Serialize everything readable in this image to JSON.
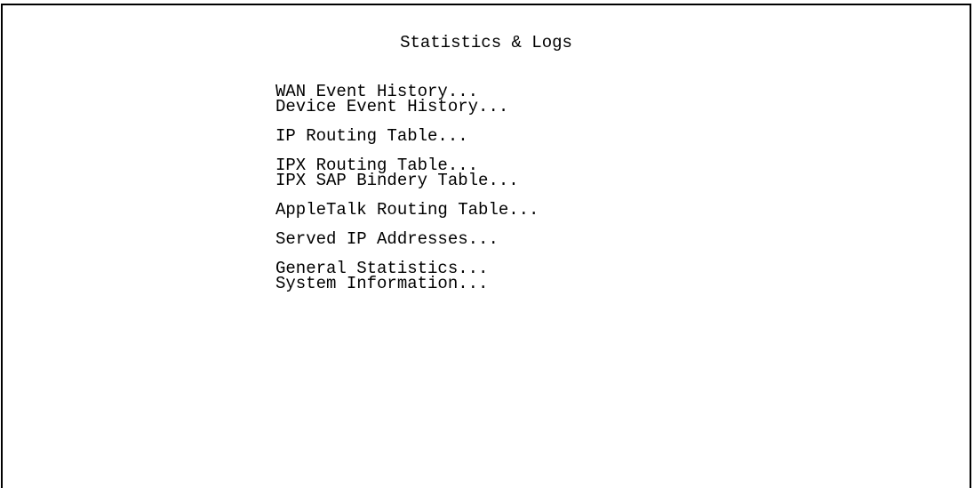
{
  "screen": {
    "title": "Statistics & Logs"
  },
  "menu": {
    "groups": [
      {
        "items": [
          "WAN Event History...",
          "Device Event History..."
        ]
      },
      {
        "items": [
          "IP Routing Table..."
        ]
      },
      {
        "items": [
          "IPX Routing Table...",
          "IPX SAP Bindery Table..."
        ]
      },
      {
        "items": [
          "AppleTalk Routing Table..."
        ]
      },
      {
        "items": [
          "Served IP Addresses..."
        ]
      },
      {
        "items": [
          "General Statistics...",
          "System Information..."
        ]
      }
    ]
  }
}
